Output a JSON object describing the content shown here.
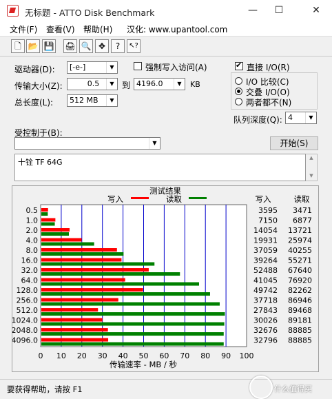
{
  "window": {
    "title": "无标题 - ATTO Disk Benchmark",
    "minimize": "—",
    "maximize": "☐",
    "close": "✕"
  },
  "menu": [
    "文件(F)",
    "查看(V)",
    "帮助(H)",
    "汉化: www.upantool.com"
  ],
  "toolbar": {
    "icons": [
      "new-file-icon",
      "open-folder-icon",
      "save-icon",
      "print-icon",
      "print-preview-icon",
      "move-icon",
      "help-icon",
      "context-help-icon"
    ],
    "glyphs": [
      "🗋",
      "📂",
      "💾",
      "🖨",
      "🔍",
      "✥",
      "?",
      "↖?"
    ]
  },
  "settings": {
    "drive_label": "驱动器(D):",
    "drive_value": "[-e-]",
    "force_write_label": "强制写入访问(A)",
    "transfer_label": "传输大小(Z):",
    "transfer_from": "0.5",
    "transfer_to_label": "到",
    "transfer_to": "4196.0",
    "transfer_unit": "KB",
    "length_label": "总长度(L):",
    "length_value": "512 MB",
    "direct_io_label": "直接 I/O(R)",
    "io_options": [
      "I/O 比较(C)",
      "交叠 I/O(O)",
      "两者都不(N)"
    ],
    "io_selected": 1,
    "queue_label": "队列深度(Q):",
    "queue_value": "4",
    "controlled_label": "受控制于(B):",
    "controlled_value": "",
    "start_button": "开始(S)",
    "description": "十铨 TF 64G"
  },
  "chart_data": {
    "type": "bar",
    "title": "测试结果",
    "legend": {
      "write": "写入",
      "read": "读取",
      "placement": "top"
    },
    "column_headers": {
      "write": "写入",
      "read": "读取"
    },
    "categories": [
      "0.5",
      "1.0",
      "2.0",
      "4.0",
      "8.0",
      "16.0",
      "32.0",
      "64.0",
      "128.0",
      "256.0",
      "512.0",
      "1024.0",
      "2048.0",
      "4096.0"
    ],
    "series": [
      {
        "name": "写入",
        "color": "#ff0000",
        "values": [
          3595,
          7150,
          14054,
          19931,
          37059,
          39264,
          52488,
          41045,
          49742,
          37718,
          27843,
          30026,
          32676,
          32796
        ]
      },
      {
        "name": "读取",
        "color": "#008000",
        "values": [
          3471,
          6877,
          13721,
          25974,
          40255,
          55271,
          67640,
          76920,
          82262,
          86946,
          89468,
          89181,
          88885,
          88885
        ]
      }
    ],
    "xlabel": "传输速率 - MB / 秒",
    "xticks": [
      "0",
      "10",
      "20",
      "30",
      "40",
      "50",
      "60",
      "70",
      "80",
      "90",
      "100"
    ],
    "xlim": [
      0,
      100
    ],
    "orientation": "horizontal",
    "grid": "vertical"
  },
  "status": {
    "text": "要获得帮助，请按 F1"
  },
  "watermark": "什么值得买"
}
